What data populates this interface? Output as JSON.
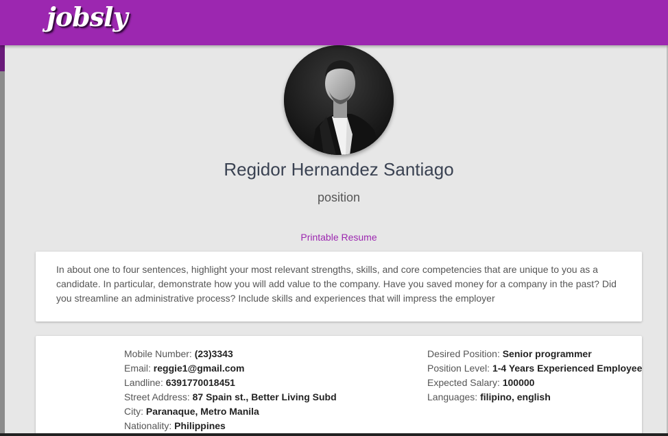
{
  "header": {
    "logo": "jobsly"
  },
  "profile": {
    "name": "Regidor Hernandez Santiago",
    "position": "position",
    "printable_link": "Printable Resume"
  },
  "summary": {
    "text": "In about one to four sentences, highlight your most relevant strengths, skills, and core competencies that are unique to you as a candidate. In particular, demonstrate how you will add value to the company. Have you saved money for a company in the past? Did you streamline an administrative process? Include skills and experiences that will impress the employer"
  },
  "details": {
    "left": [
      {
        "label": "Mobile Number: ",
        "value": "(23)3343"
      },
      {
        "label": "Email: ",
        "value": "reggie1@gmail.com"
      },
      {
        "label": "Landline: ",
        "value": "6391770018451"
      },
      {
        "label": "Street Address: ",
        "value": "87 Spain st., Better Living Subd"
      },
      {
        "label": "City: ",
        "value": "Paranaque, Metro Manila"
      },
      {
        "label": "Nationality: ",
        "value": "Philippines"
      }
    ],
    "right": [
      {
        "label": "Desired Position: ",
        "value": "Senior programmer"
      },
      {
        "label": "Position Level: ",
        "value": "1-4 Years Experienced Employee"
      },
      {
        "label": "Expected Salary: ",
        "value": "100000"
      },
      {
        "label": "Languages: ",
        "value": "filipino, english"
      }
    ]
  },
  "colors": {
    "brand": "#9c27b0",
    "background": "#e7e7e7",
    "name_text": "#3a4252"
  }
}
